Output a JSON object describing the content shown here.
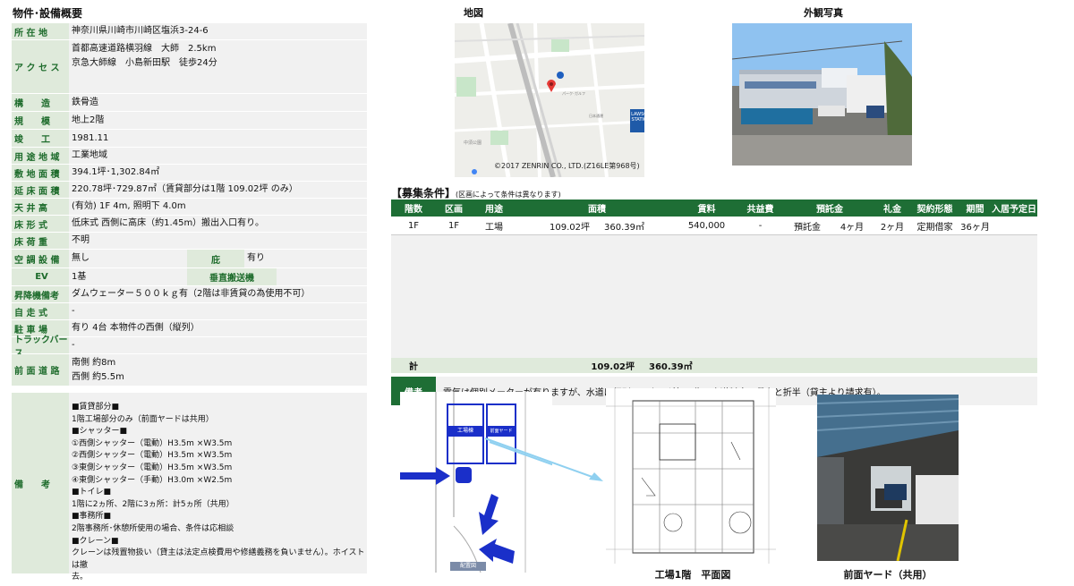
{
  "spec": {
    "title": "物件･設備概要",
    "rows": {
      "address": {
        "label": "所 在 地",
        "value": "神奈川県川崎市川崎区塩浜3-24-6"
      },
      "access": {
        "label": "ア ク セ ス",
        "line1": "首都高速道路横羽線　大師　2.5km",
        "line2": "京急大師線　小島新田駅　徒歩24分"
      },
      "structure": {
        "label": "構　　造",
        "value": "鉄骨造"
      },
      "scale": {
        "label": "規　　模",
        "value": "地上2階"
      },
      "completed": {
        "label": "竣　　工",
        "value": "1981.11"
      },
      "zoning": {
        "label": "用 途 地 域",
        "value": "工業地域"
      },
      "land_area": {
        "label": "敷 地 面 積",
        "value": "394.1坪･1,302.84㎡"
      },
      "floor_area": {
        "label": "延 床 面 積",
        "value": "220.78坪･729.87㎡（賃貸部分は1階 109.02坪 のみ）"
      },
      "ceiling": {
        "label": "天 井 高",
        "value": "(有効) 1F 4m, 照明下 4.0m"
      },
      "floor_type": {
        "label": "床 形 式",
        "value": "低床式 西側に高床（約1.45m）搬出入口有り。"
      },
      "floor_load": {
        "label": "床 荷 重",
        "value": "不明"
      },
      "aircon": {
        "label": "空 調 設 備",
        "value": "無し",
        "label2": "庇",
        "value2": "有り"
      },
      "ev": {
        "label": "EV",
        "value": "1基",
        "label2": "垂直搬送機",
        "value2": ""
      },
      "elevator_note": {
        "label": "昇降機備考",
        "value": "ダムウェーター５００ｋｇ有（2階は非賃貸の為使用不可）"
      },
      "self_drive": {
        "label": "自 走 式",
        "value": "-"
      },
      "parking": {
        "label": "駐 車 場",
        "value": "有り 4台 本物件の西側（縦列）"
      },
      "truck_berth": {
        "label": "トラックバース",
        "value": "-"
      },
      "front_road": {
        "label": "前 面 道 路",
        "line1": "南側 約8m",
        "line2": "西側 約5.5m"
      },
      "remarks": {
        "label": "備　　考",
        "lines": [
          "■賃貸部分■",
          "1階工場部分のみ（前面ヤードは共用）",
          "■シャッター■",
          "①西側シャッター（電動）H3.5m ×W3.5m",
          "②西側シャッター（電動）H3.5m ×W3.5m",
          "③東側シャッター（電動）H3.5m ×W3.5m",
          "④東側シャッター（手動）H3.0m ×W2.5m",
          "■トイレ■",
          "1階に2ヵ所、2階に3ヵ所：計5ヵ所（共用）",
          "■事務所■",
          "2階事務所･休憩所使用の場合、条件は応相談",
          "■クレーン■",
          "クレーンは残置物扱い（貸主は法定点検費用や修繕義務を負いません）。ホイストは撤",
          "去。"
        ]
      }
    }
  },
  "map": {
    "title": "地図",
    "credit": "©2017 ZENRIN CO., LTD.(Z16LE第968号)",
    "station_badge": "LAWSON STATION"
  },
  "exterior": {
    "title": "外観写真"
  },
  "conditions": {
    "title": "【募集条件】",
    "subtitle": "(区画によって条件は異なります)",
    "headers": [
      "階数",
      "区画",
      "用途",
      "面積",
      "賃料",
      "共益費",
      "預託金",
      "礼金",
      "契約形態",
      "期間",
      "入居予定日"
    ],
    "row": {
      "floor": "1F",
      "section": "1F",
      "use": "工場",
      "tsubo": "109.02坪",
      "sqm": "360.39㎡",
      "rent": "540,000",
      "common": "-",
      "deposit_type": "預託金",
      "deposit": "4ヶ月",
      "key_money": "2ヶ月",
      "contract": "定期借家",
      "term": "36ヶ月",
      "move_in": ""
    },
    "total": {
      "label": "計",
      "tsubo": "109.02坪",
      "sqm": "360.39㎡"
    },
    "note": {
      "label": "備考",
      "text": "電気は個別メーターが有りますが、水道は個別メーターが無い為、水道料金は貸主と折半（貸主より請求有）。"
    }
  },
  "diagrams": {
    "layout_caption": "配置図",
    "layout_factory": "工場棟",
    "layout_yard": "前面ヤード",
    "floor_plan_caption": "工場1階　平面図",
    "yard_caption": "前面ヤード（共用）"
  },
  "colors": {
    "accent": "#1e6e35",
    "label_bg": "#dfeadb",
    "row_bg": "#f1f1f1",
    "arrow": "#1a2fc9"
  }
}
